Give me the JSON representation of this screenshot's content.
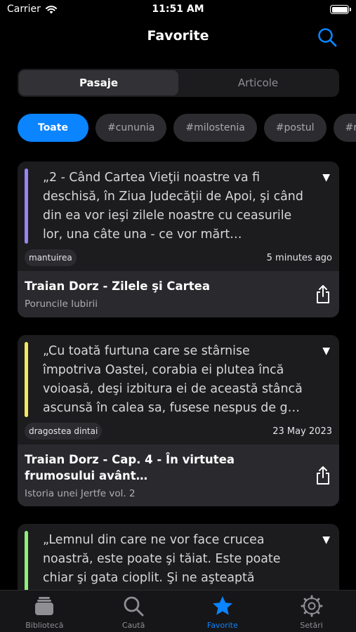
{
  "status": {
    "carrier": "Carrier",
    "time": "11:51 AM"
  },
  "nav": {
    "title": "Favorite"
  },
  "segments": [
    {
      "label": "Pasaje",
      "active": true
    },
    {
      "label": "Articole",
      "active": false
    }
  ],
  "chips": [
    "Toate",
    "#cununia",
    "#milostenia",
    "#postul",
    "#ru"
  ],
  "cards": [
    {
      "accent": "#9a84f2",
      "quote": "„2 - Când Cartea Vieţii noastre va fi deschisă, în Ziua Judecăţii de Apoi, şi când din ea vor ieşi zilele noastre cu ceasurile lor, una câte una - ce vor mărt…",
      "tag": "mantuirea",
      "date": "5 minutes ago",
      "title": "Traian Dorz - Zilele şi Cartea",
      "source": "Poruncile Iubirii"
    },
    {
      "accent": "#f5e663",
      "quote": "„Cu toată furtuna care se stârnise împotriva Oastei, corabia ei plutea încă voioasă, deşi izbitura ei de această stâncă ascunsă în calea sa, fusese nespus de g…",
      "tag": "dragostea dintai",
      "date": "23 May 2023",
      "title": "Traian Dorz - Cap. 4 - În virtutea frumosului avânt…",
      "source": "Istoria unei Jertfe vol. 2"
    },
    {
      "accent": "#8ef07a",
      "quote": "„Lemnul din care ne vor face crucea noastră, este poate şi tăiat. Este poate chiar şi gata cioplit. Şi ne aşteaptă",
      "tag": "",
      "date": "",
      "title": "",
      "source": ""
    }
  ],
  "tabs": [
    {
      "label": "Bibliotecă",
      "icon": "library-icon",
      "active": false
    },
    {
      "label": "Caută",
      "icon": "search-icon",
      "active": false
    },
    {
      "label": "Favorite",
      "icon": "star-icon",
      "active": true
    },
    {
      "label": "Setări",
      "icon": "gear-icon",
      "active": false
    }
  ],
  "colors": {
    "accent": "#0a84ff",
    "background": "#000000",
    "card": "#1c1c1e"
  }
}
